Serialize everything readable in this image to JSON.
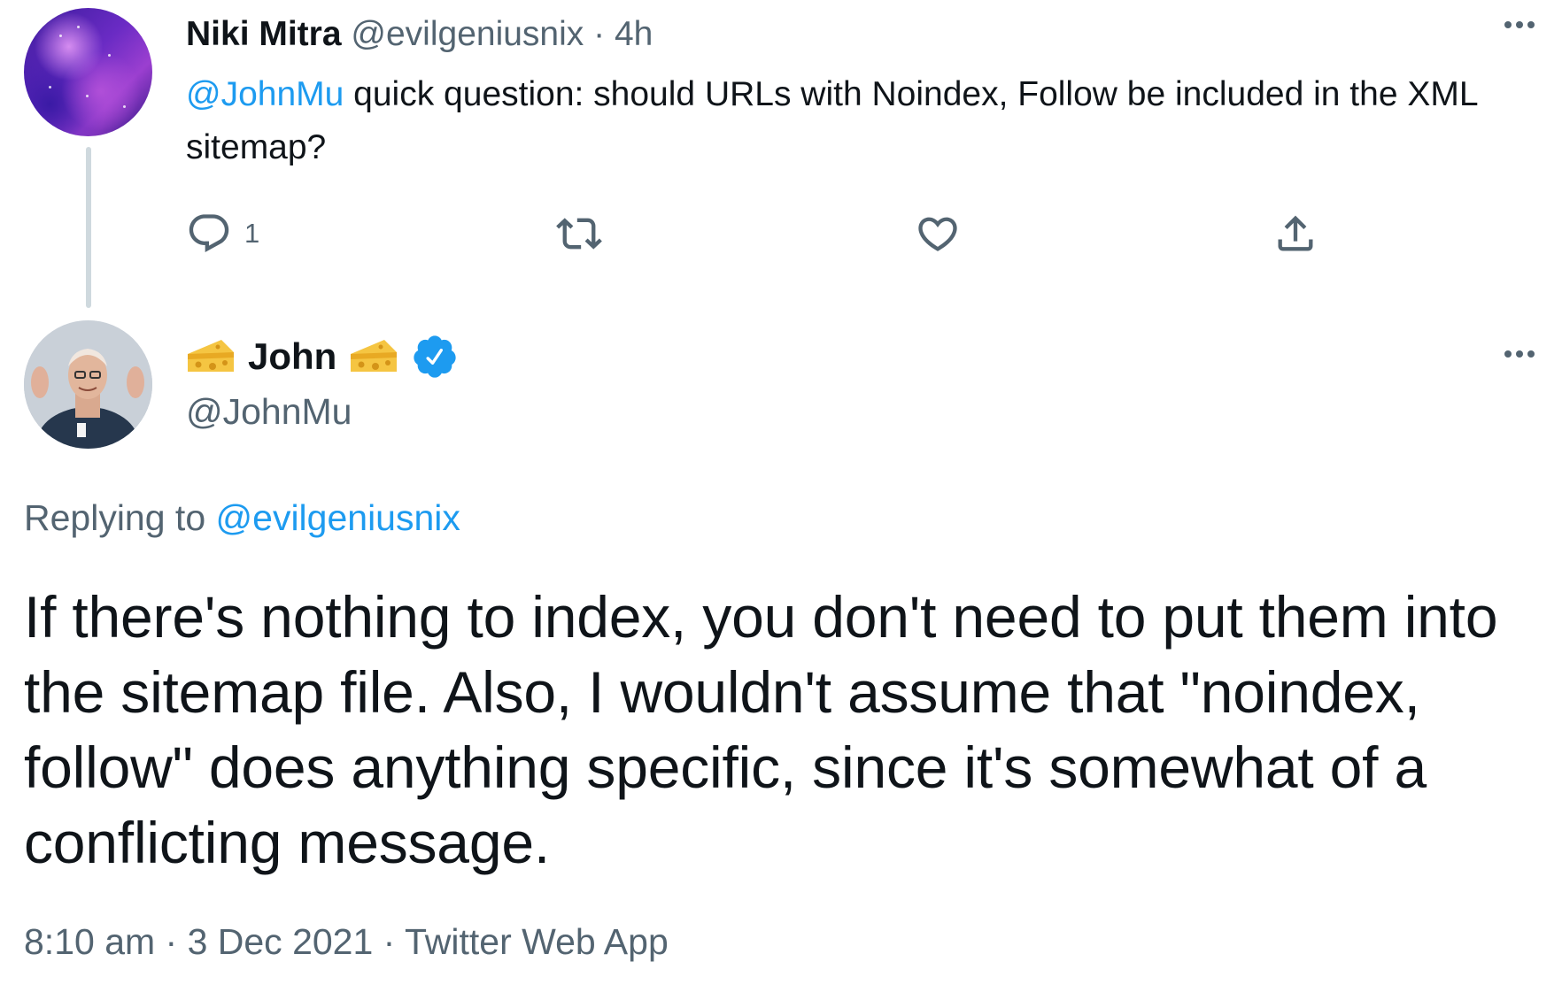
{
  "tweet1": {
    "name": "Niki Mitra",
    "handle": "@evilgeniusnix",
    "separator": "·",
    "time": "4h",
    "mention": "@JohnMu",
    "text": " quick question: should URLs with Noindex, Follow be included in the XML sitemap?",
    "reply_count": "1",
    "icons": [
      "reply-icon",
      "retweet-icon",
      "like-icon",
      "share-icon",
      "more-icon"
    ]
  },
  "tweet2": {
    "name": "John",
    "handle": "@JohnMu",
    "verified": true,
    "replying_prefix": "Replying to ",
    "replying_handle": "@evilgeniusnix",
    "text": "If there's nothing to index, you don't need to put them into the sitemap file. Also, I wouldn't assume that \"noindex, follow\" does anything specific, since it's somewhat of a conflicting message.",
    "meta": "8:10 am · 3 Dec 2021 · Twitter Web App",
    "icons": [
      "cheese-icon",
      "verified-badge-icon",
      "more-icon"
    ]
  },
  "colors": {
    "link": "#1d9bf0",
    "muted": "#536471",
    "text": "#0f1419",
    "thread_line": "#cfd9de"
  }
}
